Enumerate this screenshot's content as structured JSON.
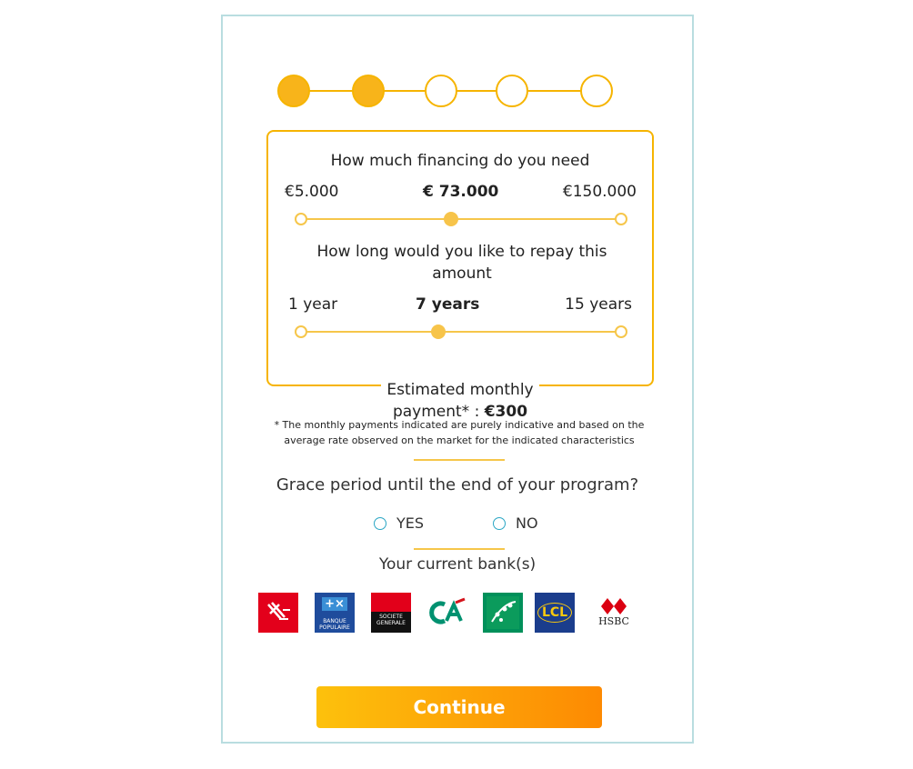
{
  "stepper": {
    "steps": [
      {
        "state": "completed"
      },
      {
        "state": "active"
      },
      {
        "state": "pending"
      },
      {
        "state": "pending"
      },
      {
        "state": "pending"
      }
    ],
    "accent_color": "#f6b400"
  },
  "financing": {
    "question": "How much financing do you need",
    "min_label": "€5.000",
    "value_label": "€ 73.000",
    "max_label": "€150.000",
    "min": 5000,
    "max": 150000,
    "value": 73000
  },
  "duration": {
    "question": "How long would you like to repay this amount",
    "min_label": "1 year",
    "value_label": "7 years",
    "max_label": "15 years",
    "min": 1,
    "max": 15,
    "value": 7
  },
  "estimate": {
    "label": "Estimated monthly payment* :",
    "value": "€300"
  },
  "note": "* The monthly payments indicated are purely indicative and based on the average rate observed on the market for the indicated characteristics",
  "grace": {
    "question": "Grace period until the end of your program?",
    "options": [
      "YES",
      "NO"
    ]
  },
  "banks": {
    "question": "Your current bank(s)",
    "items": [
      {
        "name": "Caisse d'Epargne",
        "icon": "caisse-epargne-logo",
        "color": "#e3001b"
      },
      {
        "name": "Banque Populaire",
        "icon": "banque-populaire-logo",
        "text": "BANQUE POPULAIRE",
        "color": "#1f4c9c"
      },
      {
        "name": "Société Générale",
        "icon": "societe-generale-logo",
        "text": "SOCIETE GENERALE",
        "color": "#e2001a"
      },
      {
        "name": "Crédit Agricole",
        "icon": "credit-agricole-logo",
        "color": "#00855f"
      },
      {
        "name": "BNP Paribas",
        "icon": "bnp-paribas-logo",
        "color": "#008e46"
      },
      {
        "name": "LCL",
        "icon": "lcl-logo",
        "text": "LCL",
        "color": "#1b3d8c"
      },
      {
        "name": "HSBC",
        "icon": "hsbc-logo",
        "text": "HSBC",
        "color": "#db0011"
      }
    ]
  },
  "continue_label": "Continue"
}
